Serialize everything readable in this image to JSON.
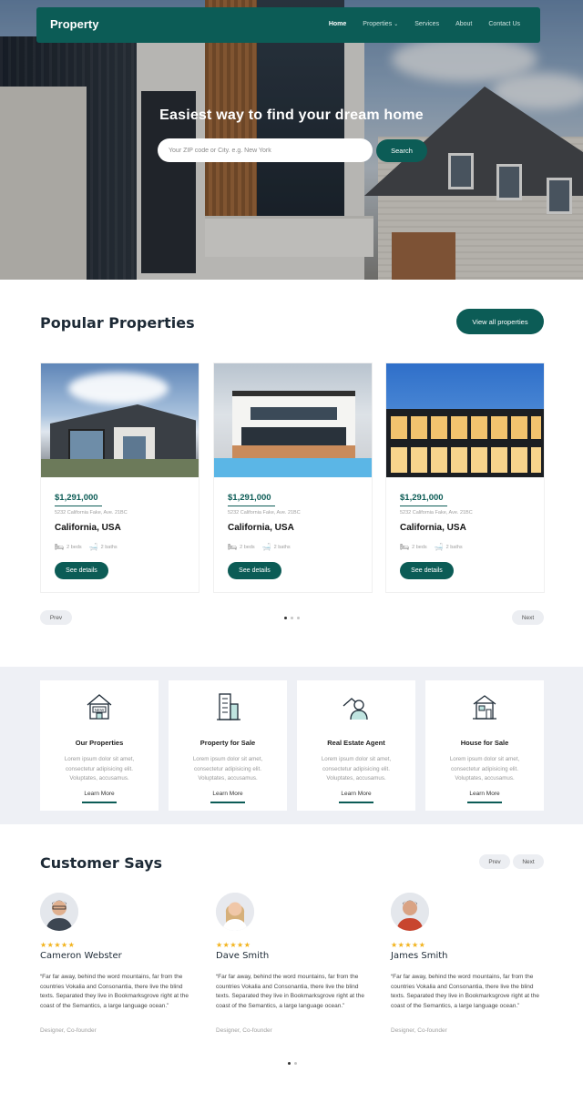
{
  "nav": {
    "brand": "Property",
    "items": [
      "Home",
      "Properties",
      "Services",
      "About",
      "Contact Us"
    ]
  },
  "hero": {
    "title": "Easiest way to find your dream home",
    "search_placeholder": "Your ZIP code or City. e.g. New York",
    "search_button": "Search"
  },
  "popular": {
    "title": "Popular Properties",
    "view_all": "View all properties",
    "cards": [
      {
        "price": "$1,291,000",
        "address": "5232 California Fake, Ave. 21BC",
        "city": "California, USA",
        "beds": "2 beds",
        "baths": "2 baths",
        "button": "See details"
      },
      {
        "price": "$1,291,000",
        "address": "5232 California Fake, Ave. 21BC",
        "city": "California, USA",
        "beds": "2 beds",
        "baths": "2 baths",
        "button": "See details"
      },
      {
        "price": "$1,291,000",
        "address": "5232 California Fake, Ave. 21BC",
        "city": "California, USA",
        "beds": "2 beds",
        "baths": "2 baths",
        "button": "See details"
      }
    ],
    "prev": "Prev",
    "next": "Next"
  },
  "services": [
    {
      "title": "Our Properties",
      "desc": "Lorem ipsum dolor sit amet, consectetur adipisicing elit. Voluptates, accusamus.",
      "link": "Learn More"
    },
    {
      "title": "Property for Sale",
      "desc": "Lorem ipsum dolor sit amet, consectetur adipisicing elit. Voluptates, accusamus.",
      "link": "Learn More"
    },
    {
      "title": "Real Estate Agent",
      "desc": "Lorem ipsum dolor sit amet, consectetur adipisicing elit. Voluptates, accusamus.",
      "link": "Learn More"
    },
    {
      "title": "House for Sale",
      "desc": "Lorem ipsum dolor sit amet, consectetur adipisicing elit. Voluptates, accusamus.",
      "link": "Learn More"
    }
  ],
  "testimonials": {
    "title": "Customer Says",
    "prev": "Prev",
    "next": "Next",
    "items": [
      {
        "stars": "★★★★★",
        "name": "Cameron Webster",
        "quote": "“Far far away, behind the word mountains, far from the countries Vokalia and Consonantia, there live the blind texts. Separated they live in Bookmarksgrove right at the coast of the Semantics, a large language ocean.”",
        "role": "Designer, Co-founder"
      },
      {
        "stars": "★★★★★",
        "name": "Dave Smith",
        "quote": "“Far far away, behind the word mountains, far from the countries Vokalia and Consonantia, there live the blind texts. Separated they live in Bookmarksgrove right at the coast of the Semantics, a large language ocean.”",
        "role": "Designer, Co-founder"
      },
      {
        "stars": "★★★★★",
        "name": "James Smith",
        "quote": "“Far far away, behind the word mountains, far from the countries Vokalia and Consonantia, there live the blind texts. Separated they live in Bookmarksgrove right at the coast of the Semantics, a large language ocean.”",
        "role": "Designer, Co-founder"
      }
    ]
  },
  "colors": {
    "brand": "#0c5c56",
    "star": "#f2b31c",
    "section_bg": "#eef0f5"
  }
}
